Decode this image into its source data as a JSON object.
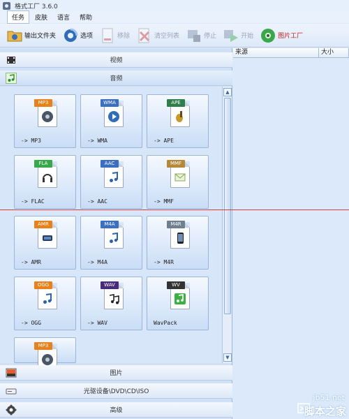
{
  "window": {
    "title": "格式工厂 3.6.0"
  },
  "menu": [
    {
      "label": "任务",
      "active": true
    },
    {
      "label": "皮肤",
      "active": false
    },
    {
      "label": "语言",
      "active": false
    },
    {
      "label": "帮助",
      "active": false
    }
  ],
  "toolbar": {
    "output_folder": "输出文件夹",
    "options": "选项",
    "remove": "移除",
    "clear_list": "清空列表",
    "stop": "停止",
    "start": "开始",
    "picture_factory": "图片工厂"
  },
  "categories": {
    "video": "视频",
    "audio": "音频",
    "picture": "图片",
    "disc": "光驱设备\\DVD\\CD\\ISO",
    "advanced": "高级"
  },
  "audio_tiles": [
    {
      "label": "-> MP3",
      "badge": "MP3",
      "badge_color": "#e8811a",
      "icon": "speaker-icon"
    },
    {
      "label": "-> WMA",
      "badge": "WMA",
      "badge_color": "#3d6fc0",
      "icon": "play-icon"
    },
    {
      "label": "-> APE",
      "badge": "APE",
      "badge_color": "#2e7d4a",
      "icon": "guitar-icon"
    },
    {
      "label": "-> FLAC",
      "badge": "FLA",
      "badge_color": "#3aa84a",
      "icon": "headphones-icon"
    },
    {
      "label": "-> AAC",
      "badge": "AAC",
      "badge_color": "#3d6fc0",
      "icon": "music-note-icon"
    },
    {
      "label": "-> MMF",
      "badge": "MMF",
      "badge_color": "#b4893a",
      "icon": "envelope-icon"
    },
    {
      "label": "-> AMR",
      "badge": "AMR",
      "badge_color": "#e8811a",
      "icon": "phone-icon"
    },
    {
      "label": "-> M4A",
      "badge": "M4A",
      "badge_color": "#3d6fc0",
      "icon": "music-note-icon"
    },
    {
      "label": "-> M4R",
      "badge": "M4R",
      "badge_color": "#6f7f8f",
      "icon": "iphone-icon"
    },
    {
      "label": "-> OGG",
      "badge": "OGG",
      "badge_color": "#e8811a",
      "icon": "music-note-icon"
    },
    {
      "label": "-> WAV",
      "badge": "WAV",
      "badge_color": "#4a2b7a",
      "icon": "music-notes-icon"
    },
    {
      "label": "WavPack",
      "badge": "WV",
      "badge_color": "#333333",
      "icon": "green-note-icon"
    },
    {
      "label": "",
      "badge": "MP3",
      "badge_color": "#e8811a",
      "icon": "speaker-icon"
    }
  ],
  "file_list": {
    "col_source": "来源",
    "col_size": "大小"
  },
  "watermark": {
    "site": "jb51.net",
    "name": "脚本之家"
  }
}
